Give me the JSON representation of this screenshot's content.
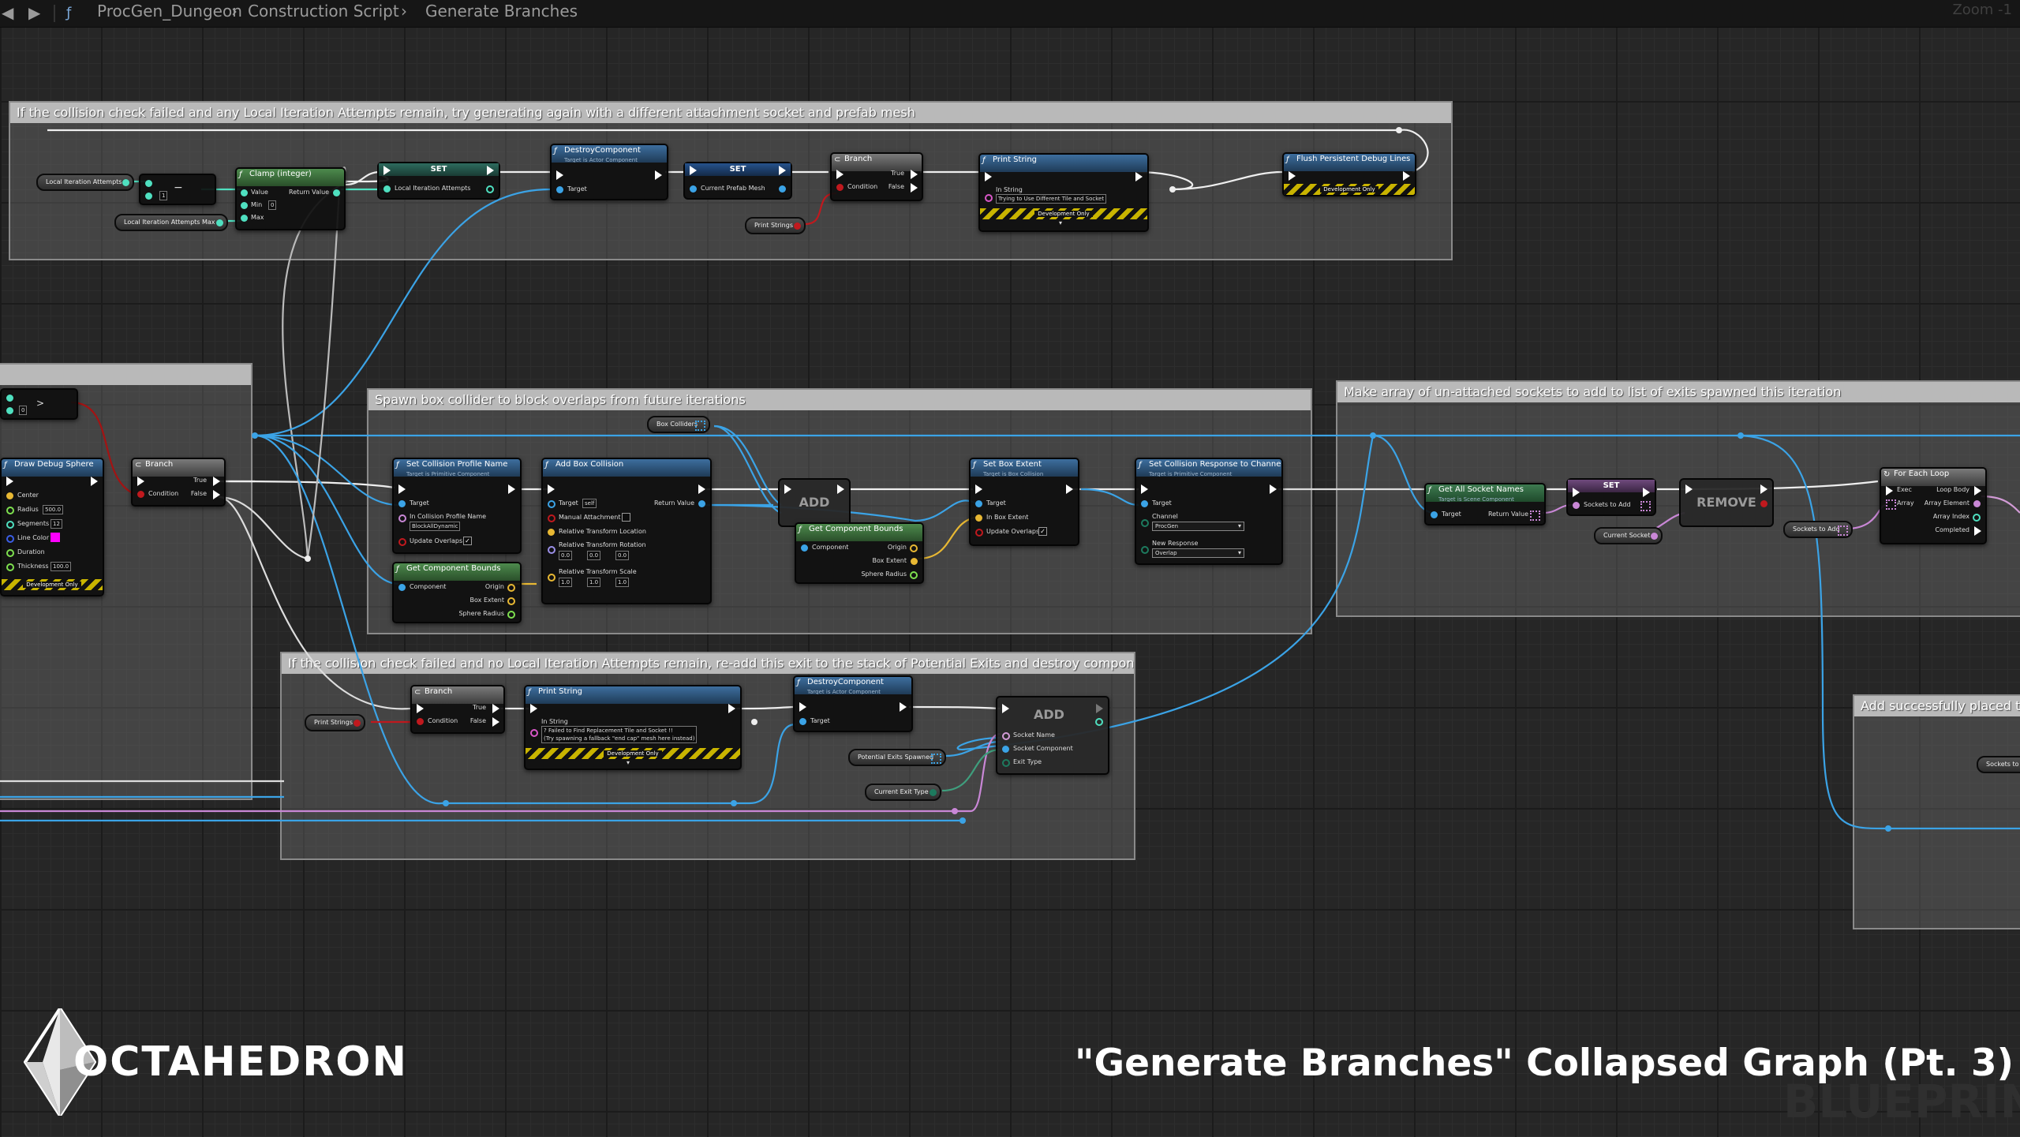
{
  "breadcrumb": {
    "back_icon": "back-arrow-icon",
    "forward_icon": "forward-arrow-icon",
    "blueprint": "ProcGen_Dungeon",
    "function": "Construction Script",
    "graph": "Generate Branches"
  },
  "zoom_label": "Zoom -1",
  "comments": {
    "retry": "If the collision check failed and any Local Iteration Attempts remain, try generating again with a different attachment socket and prefab mesh",
    "box": "Spawn box collider to block overlaps from future iterations",
    "sockets": "Make array of un-attached sockets to add to list of exits spawned this iteration",
    "fail": "If the collision check failed and no Local Iteration Attempts remain, re-add this exit to the stack of Potential Exits and destroy component",
    "placed": "Add successfully placed tile"
  },
  "nodes": {
    "local_iter": "Local Iteration Attempts",
    "local_iter_max": "Local Iteration Attempts Max",
    "minus_val": "1",
    "clamp": {
      "title": "Clamp (integer)",
      "value": "Value",
      "min": "Min",
      "min_val": "0",
      "max": "Max",
      "ret": "Return Value"
    },
    "set1": {
      "title": "SET",
      "pin": "Local Iteration Attempts"
    },
    "destroy1": {
      "title": "DestroyComponent",
      "sub": "Target is Actor Component",
      "target": "Target"
    },
    "set2": {
      "title": "SET",
      "pin": "Current Prefab Mesh"
    },
    "branch1": {
      "title": "Branch",
      "cond": "Condition",
      "t": "True",
      "f": "False"
    },
    "print_strings1": "Print Strings",
    "print1": {
      "title": "Print String",
      "in": "In String",
      "val": "Trying to Use Different Tile and Socket",
      "dev": "Development Only"
    },
    "flush": {
      "title": "Flush Persistent Debug Lines",
      "dev": "Development Only"
    },
    "compare": {
      "op": ">",
      "val": "0"
    },
    "sphere": {
      "title": "Draw Debug Sphere",
      "center": "Center",
      "radius": "Radius",
      "radius_val": "500.0",
      "segments": "Segments",
      "segments_val": "12",
      "color": "Line Color",
      "duration": "Duration",
      "thickness": "Thickness",
      "thickness_val": "100.0",
      "dev": "Development Only"
    },
    "branch2": {
      "title": "Branch",
      "cond": "Condition",
      "t": "True",
      "f": "False"
    },
    "box_colliders": "Box Colliders",
    "profile": {
      "title": "Set Collision Profile Name",
      "sub": "Target is Primitive Component",
      "target": "Target",
      "in_name": "In Collision Profile Name",
      "in_val": "BlockAllDynamic",
      "overlaps": "Update Overlaps"
    },
    "gcb1": {
      "title": "Get Component Bounds",
      "comp": "Component",
      "origin": "Origin",
      "extent": "Box Extent",
      "radius": "Sphere Radius"
    },
    "addbox": {
      "title": "Add Box Collision",
      "target": "Target",
      "self": "self",
      "manual": "Manual Attachment",
      "loc": "Relative Transform Location",
      "rot": "Relative Transform Rotation",
      "scale": "Relative Transform Scale",
      "ret": "Return Value",
      "v0": "0.0",
      "v1": "1.0"
    },
    "add1": "ADD",
    "gcb2": {
      "title": "Get Component Bounds",
      "comp": "Component",
      "origin": "Origin",
      "extent": "Box Extent",
      "radius": "Sphere Radius"
    },
    "extent": {
      "title": "Set Box Extent",
      "sub": "Target is Box Collision",
      "target": "Target",
      "in": "In Box Extent",
      "overlaps": "Update Overlaps"
    },
    "response": {
      "title": "Set Collision Response to Channel",
      "sub": "Target is Primitive Component",
      "target": "Target",
      "channel": "Channel",
      "channel_val": "ProcGen",
      "resp": "New Response",
      "resp_val": "Overlap"
    },
    "getsockets": {
      "title": "Get All Socket Names",
      "sub": "Target is Scene Component",
      "target": "Target",
      "ret": "Return Value"
    },
    "set3": {
      "title": "SET",
      "pin": "Sockets to Add"
    },
    "remove": "REMOVE",
    "current_socket": "Current Socket",
    "sockets_to_add": "Sockets to Add",
    "foreach": {
      "title": "For Each Loop",
      "exec": "Exec",
      "array": "Array",
      "body": "Loop Body",
      "elem": "Array Element",
      "index": "Array Index",
      "done": "Completed"
    },
    "print_strings2": "Print Strings",
    "branch3": {
      "title": "Branch",
      "cond": "Condition",
      "t": "True",
      "f": "False"
    },
    "print2": {
      "title": "Print String",
      "in": "In String",
      "val1": "? Failed to Find Replacement Tile and Socket !!",
      "val2": "(Try spawning a fallback \"end cap\" mesh here instead)",
      "dev": "Development Only"
    },
    "destroy2": {
      "title": "DestroyComponent",
      "sub": "Target is Actor Component",
      "target": "Target"
    },
    "add2": {
      "title": "ADD",
      "a": "Socket Name",
      "b": "Socket Component",
      "c": "Exit Type"
    },
    "potential": "Potential Exits Spawned",
    "exit_type": "Current Exit Type",
    "placed_var": "Sockets to"
  },
  "branding": {
    "logo_icon": "octahedron-logo-icon",
    "logo_text": "OCTAHEDRON",
    "caption": "\"Generate Branches\" Collapsed Graph (Pt. 3)",
    "watermark": "BLUEPRINT"
  }
}
